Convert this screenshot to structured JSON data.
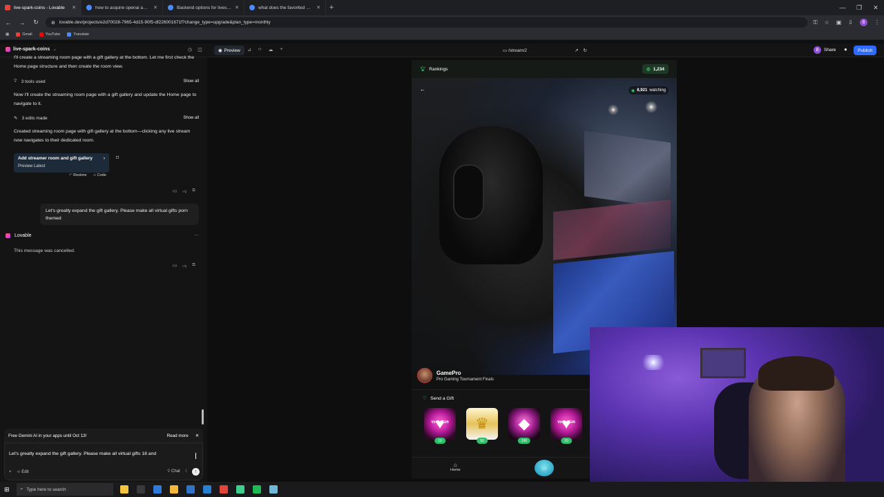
{
  "browser": {
    "tabs": [
      {
        "label": "live-spark-coins - Lovable",
        "active": true
      },
      {
        "label": "how to acquire openai api key",
        "active": false
      },
      {
        "label": "Backend options for livestream",
        "active": false
      },
      {
        "label": "what does the favorited app u",
        "active": false
      }
    ],
    "url": "lovable.dev/projects/e2d70028-7965-4d15-90f5-df226001671f?change_type=upgrade&plan_type=monthly",
    "bookmarks": [
      "Gmail",
      "YouTube",
      "Translate"
    ],
    "profile_initial": "B"
  },
  "app": {
    "project_name": "live-spark-coins",
    "preview_label": "Preview",
    "route": "/stream/2",
    "share_label": "Share",
    "publish_label": "Publish"
  },
  "chat": {
    "intro_text": "I'll create a streaming room page with a gift gallery at the bottom. Let me first check the Home page structure and then create the room view.",
    "tools_used": "3 tools used",
    "show_all": "Show all",
    "text2": "Now I'll create the streaming room page with a gift gallery and update the Home page to navigate to it.",
    "edits_made": "3 edits made",
    "text3": "Created streaming room page with gift gallery at the bottom—clicking any live stream now navigates to their dedicated room.",
    "card_title": "Add streamer room and gift gallery",
    "card_sub": "Preview Latest",
    "restore": "Restore",
    "code": "Code",
    "user_message": "Let's greatly expand the gift gallery. Please make all virtual gifts porn themed",
    "assistant_name": "Lovable",
    "cancelled": "This message was cancelled.",
    "promo_text": "Free Gemini AI in your apps until Oct 13!",
    "read_more": "Read more",
    "input_value": "Let's greatly expand the gift gallery. Please make all virtual gifts 18 and",
    "edit_label": "Edit",
    "chat_label": "Chat"
  },
  "stream": {
    "rankings_label": "Rankings",
    "coins": "1,234",
    "watching_count": "8,921",
    "watching_label": "watching",
    "streamer_name": "GamePro",
    "stream_title": "Pro Gaming Tournament Finals",
    "send_gift_label": "Send a Gift",
    "gifts": [
      {
        "type": "heart",
        "label": "Virtual Gift",
        "price": "10"
      },
      {
        "type": "crown",
        "label": "",
        "price": "50"
      },
      {
        "type": "diamond",
        "label": "",
        "price": "100"
      },
      {
        "type": "heart",
        "label": "Virtual Gift",
        "price": "10"
      }
    ],
    "nav_home": "Home"
  },
  "taskbar": {
    "search_placeholder": "Type here to search"
  }
}
